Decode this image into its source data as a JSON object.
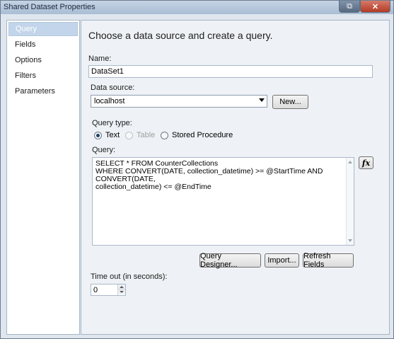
{
  "window": {
    "title": "Shared Dataset Properties",
    "restore_icon": "restore-icon",
    "close_icon": "close-icon"
  },
  "sidebar": {
    "items": [
      {
        "label": "Query",
        "active": true
      },
      {
        "label": "Fields",
        "active": false
      },
      {
        "label": "Options",
        "active": false
      },
      {
        "label": "Filters",
        "active": false
      },
      {
        "label": "Parameters",
        "active": false
      }
    ]
  },
  "main": {
    "heading": "Choose a data source and create a query.",
    "name_label": "Name:",
    "name_value": "DataSet1",
    "datasource_label": "Data source:",
    "datasource_value": "localhost",
    "new_button": "New...",
    "query_type_label": "Query type:",
    "query_types": [
      {
        "label": "Text",
        "checked": true,
        "enabled": true
      },
      {
        "label": "Table",
        "checked": false,
        "enabled": false
      },
      {
        "label": "Stored Procedure",
        "checked": false,
        "enabled": true
      }
    ],
    "query_label": "Query:",
    "query_text": "SELECT * FROM CounterCollections\nWHERE CONVERT(DATE, collection_datetime) >= @StartTime AND CONVERT(DATE,\ncollection_datetime) <= @EndTime",
    "fx_button": "fx",
    "query_designer_button": "Query Designer...",
    "import_button": "Import...",
    "refresh_fields_button": "Refresh Fields",
    "timeout_label": "Time out (in seconds):",
    "timeout_value": "0"
  }
}
